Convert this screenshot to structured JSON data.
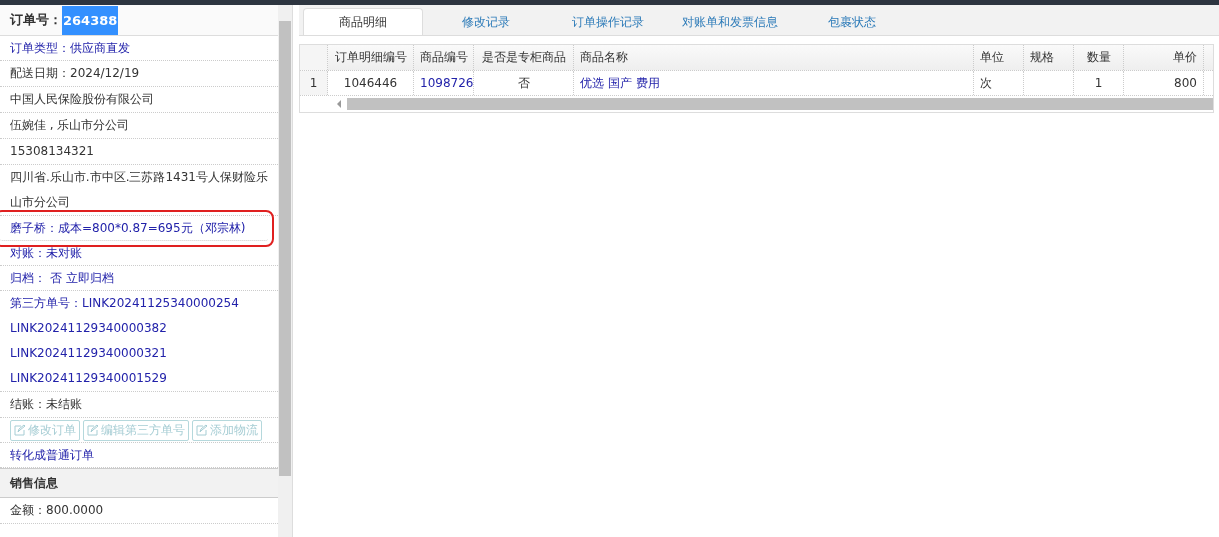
{
  "order": {
    "label": "订单号：",
    "value": "264388"
  },
  "sidebar": {
    "rows": [
      {
        "kind": "link",
        "text": "订单类型：供应商直发",
        "highlighted": false
      },
      {
        "kind": "text",
        "text": "配送日期：2024/12/19",
        "highlighted": false
      },
      {
        "kind": "text",
        "text": "中国人民保险股份有限公司",
        "highlighted": false
      },
      {
        "kind": "text",
        "text": "伍婉佳 , 乐山市分公司",
        "highlighted": false
      },
      {
        "kind": "text",
        "text": "15308134321",
        "highlighted": false
      },
      {
        "kind": "text",
        "text": "四川省.乐山市.市中区.三苏路1431号人保财险乐山市分公司",
        "highlighted": false
      },
      {
        "kind": "link",
        "text": "磨子桥：成本=800*0.87=695元（邓宗林)",
        "highlighted": true
      },
      {
        "kind": "link",
        "text": "对账：未对账",
        "highlighted": false
      },
      {
        "kind": "link",
        "text": "归档： 否 立即归档",
        "highlighted": false
      },
      {
        "kind": "list",
        "lines": [
          "第三方单号：LINK20241125340000254",
          "LINK20241129340000382",
          "LINK20241129340000321",
          "LINK20241129340001529"
        ],
        "highlighted": false
      },
      {
        "kind": "text",
        "text": "结账：未结账",
        "highlighted": false
      },
      {
        "kind": "buttons",
        "buttons": [
          {
            "label": "修改订单",
            "disabled": true
          },
          {
            "label": "编辑第三方单号",
            "disabled": true
          },
          {
            "label": "添加物流",
            "disabled": true
          }
        ],
        "highlighted": false
      },
      {
        "kind": "link",
        "text": "转化成普通订单",
        "highlighted": false
      },
      {
        "kind": "section",
        "text": "销售信息",
        "highlighted": false
      },
      {
        "kind": "text",
        "text": "金额：800.0000",
        "highlighted": false
      }
    ]
  },
  "tabs": [
    {
      "label": "商品明细",
      "selected": true
    },
    {
      "label": "修改记录",
      "selected": false
    },
    {
      "label": "订单操作记录",
      "selected": false
    },
    {
      "label": "对账单和发票信息",
      "selected": false
    },
    {
      "label": "包裹状态",
      "selected": false
    }
  ],
  "table": {
    "columns": [
      "订单明细编号",
      "商品编号",
      "是否是专柜商品",
      "商品名称",
      "单位",
      "规格",
      "数量",
      "单价"
    ],
    "rows": [
      {
        "number": "1",
        "cells": [
          {
            "text": "1046446",
            "kind": "text"
          },
          {
            "text": "1098726",
            "kind": "link"
          },
          {
            "text": "否",
            "kind": "text"
          },
          {
            "text": "优选 国产 费用",
            "kind": "link"
          },
          {
            "text": "次",
            "kind": "text"
          },
          {
            "text": "",
            "kind": "text"
          },
          {
            "text": "1",
            "kind": "text"
          },
          {
            "text": "800",
            "kind": "text"
          }
        ]
      }
    ]
  }
}
